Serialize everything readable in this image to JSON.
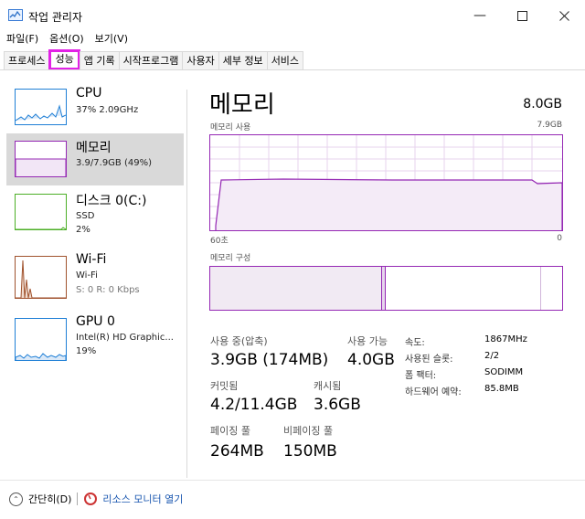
{
  "window": {
    "title": "작업 관리자"
  },
  "menu": [
    "파일(F)",
    "옵션(O)",
    "보기(V)"
  ],
  "tabs": [
    "프로세스",
    "성능",
    "앱 기록",
    "시작프로그램",
    "사용자",
    "세부 정보",
    "서비스"
  ],
  "active_tab": "성능",
  "sidebar": [
    {
      "name": "CPU",
      "sub1": "37% 2.09GHz",
      "color": "#1f7fd6"
    },
    {
      "name": "메모리",
      "sub1": "3.9/7.9GB (49%)",
      "color": "#9528b4"
    },
    {
      "name": "디스크 0(C:)",
      "sub1": "SSD",
      "sub2": "2%",
      "color": "#4caf26"
    },
    {
      "name": "Wi-Fi",
      "sub1": "Wi-Fi",
      "sub2": "S: 0 R: 0 Kbps",
      "color": "#a0522d"
    },
    {
      "name": "GPU 0",
      "sub1": "Intel(R) HD Graphic...",
      "sub2": "19%",
      "color": "#1f7fd6"
    }
  ],
  "main": {
    "title": "메모리",
    "capacity": "8.0GB",
    "usage_label": "메모리 사용",
    "usage_max": "7.9GB",
    "time_left": "60초",
    "time_right": "0",
    "composition_label": "메모리 구성",
    "usage_level_fraction": 0.49
  },
  "stats": {
    "in_use_label": "사용 중(압축)",
    "in_use_value": "3.9GB (174MB)",
    "available_label": "사용 가능",
    "available_value": "4.0GB",
    "committed_label": "커밋됨",
    "committed_value": "4.2/11.4GB",
    "cached_label": "캐시됨",
    "cached_value": "3.6GB",
    "paged_label": "페이징 풀",
    "paged_value": "264MB",
    "nonpaged_label": "비페이징 풀",
    "nonpaged_value": "150MB"
  },
  "specs": [
    {
      "label": "속도:",
      "value": "1867MHz"
    },
    {
      "label": "사용된 슬롯:",
      "value": "2/2"
    },
    {
      "label": "폼 팩터:",
      "value": "SODIMM"
    },
    {
      "label": "하드웨어 예약:",
      "value": "85.8MB"
    }
  ],
  "footer": {
    "fewer_details": "간단히(D)",
    "resource_monitor": "리소스 모니터 열기"
  },
  "colors": {
    "memory": "#9528b4",
    "highlight": "#e222e6"
  }
}
